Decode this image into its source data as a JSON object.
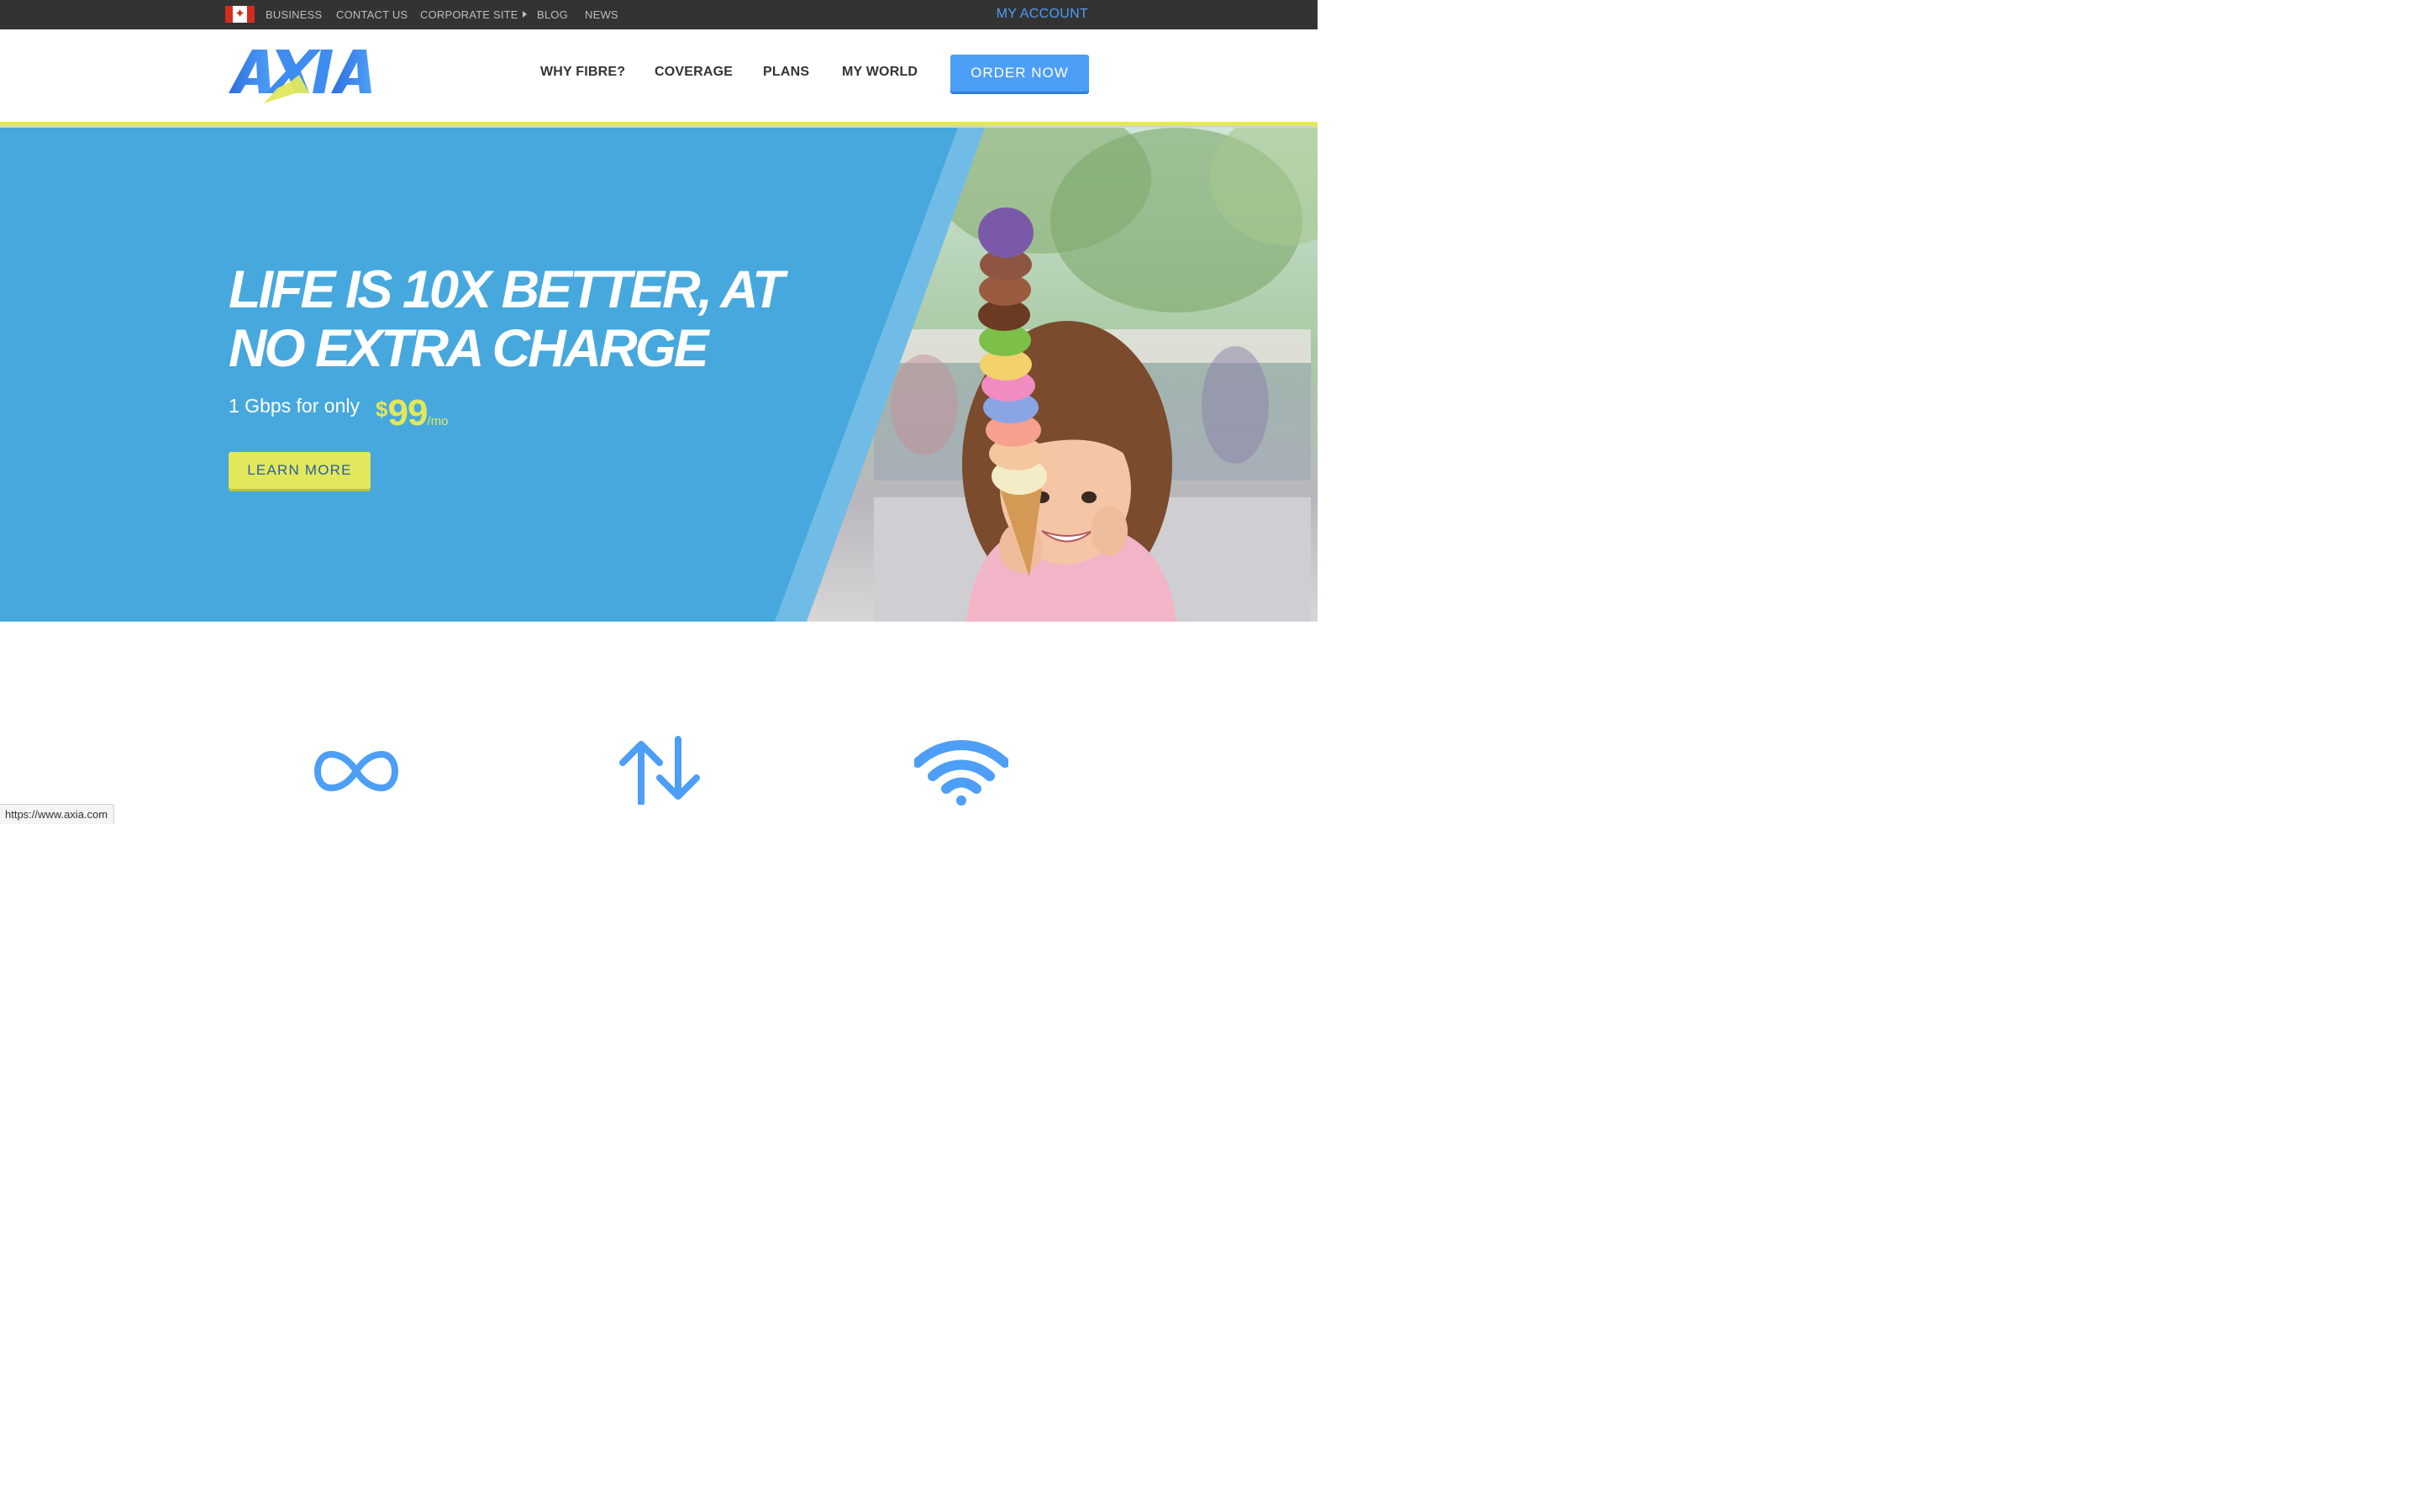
{
  "topbar": {
    "flag_icon": "canada-flag-icon",
    "links": [
      "BUSINESS",
      "CONTACT US",
      "CORPORATE SITE",
      "BLOG",
      "NEWS"
    ],
    "my_account": "MY ACCOUNT"
  },
  "header": {
    "logo_text": "AXIA",
    "nav": [
      "WHY FIBRE?",
      "COVERAGE",
      "PLANS",
      "MY WORLD"
    ],
    "order_button": "ORDER NOW"
  },
  "hero": {
    "headline": "LIFE IS 10X BETTER, AT NO EXTRA CHARGE",
    "offer_text": "1 Gbps for only",
    "price_currency": "$",
    "price_value": "99",
    "price_period": "/mo",
    "cta": "LEARN MORE",
    "image_subject": "girl-with-ice-cream-photo"
  },
  "features": {
    "icons": [
      "infinity-icon",
      "upload-download-arrows-icon",
      "wifi-icon"
    ]
  },
  "status_bar": {
    "url": "https://www.axia.com"
  },
  "colors": {
    "topbar": "#333333",
    "brand_blue": "#4d9ef6",
    "hero_blue": "#46a8dd",
    "accent_yellow": "#e2e85c",
    "nav_text": "#333333"
  }
}
